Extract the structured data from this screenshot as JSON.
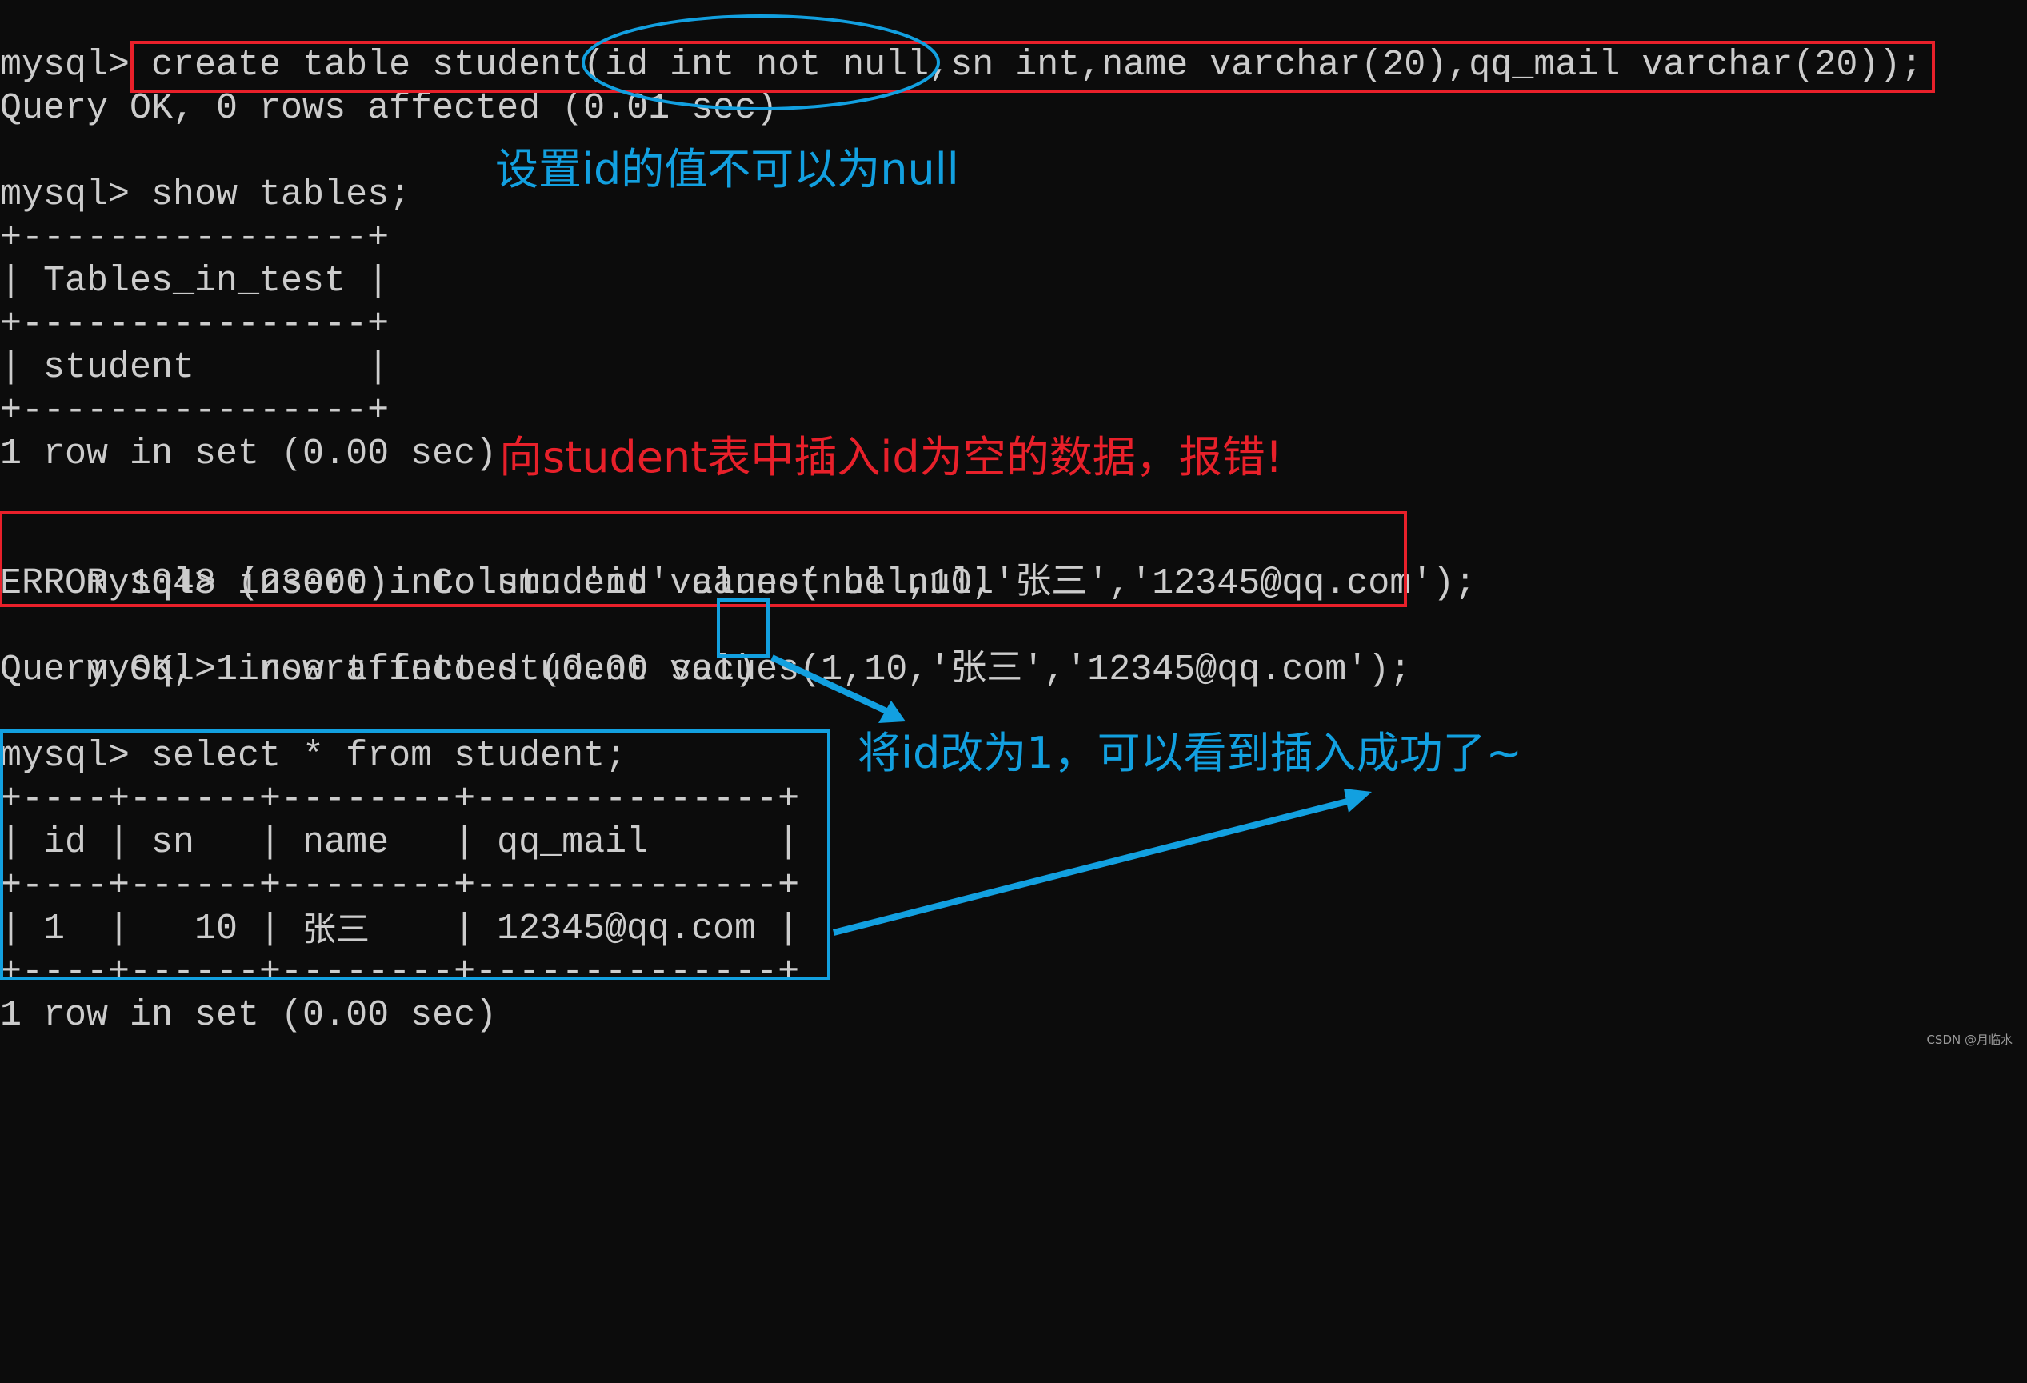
{
  "terminal": {
    "prompt": "mysql>",
    "lines": [
      "mysql> create table student(id int not null,sn int,name varchar(20),qq_mail varchar(20));",
      "Query OK, 0 rows affected (0.01 sec)",
      "",
      "mysql> show tables;",
      "+----------------+",
      "| Tables_in_test |",
      "+----------------+",
      "| student        |",
      "+----------------+",
      "1 row in set (0.00 sec)",
      "",
      "mysql> insert into student values(null,10,'张三','12345@qq.com');",
      "ERROR 1048 (23000): Column 'id' cannot be null",
      "mysql> insert into student values(1,10,'张三','12345@qq.com');",
      "Query OK, 1 row affected (0.00 sec)",
      "",
      "mysql> select * from student;",
      "+----+------+--------+--------------+",
      "| id | sn   | name   | qq_mail      |",
      "+----+------+--------+--------------+",
      "__ROW__",
      "+----+------+--------+--------------+",
      "1 row in set (0.00 sec)"
    ],
    "result_table": {
      "columns": [
        "id",
        "sn",
        "name",
        "qq_mail"
      ],
      "rows": [
        {
          "id": "1",
          "sn": "10",
          "name": "张三",
          "qq_mail": "12345@qq.com"
        }
      ]
    }
  },
  "annotations": {
    "not_null_note": "设置id的值不可以为null",
    "insert_null_note": "向student表中插入id为空的数据，报错!",
    "insert_success_note": "将id改为1，可以看到插入成功了~"
  },
  "colors": {
    "background": "#0c0c0c",
    "text": "#cccccc",
    "highlight_red": "#e8202a",
    "highlight_blue": "#12a0e0"
  },
  "watermark": "CSDN @月临水"
}
